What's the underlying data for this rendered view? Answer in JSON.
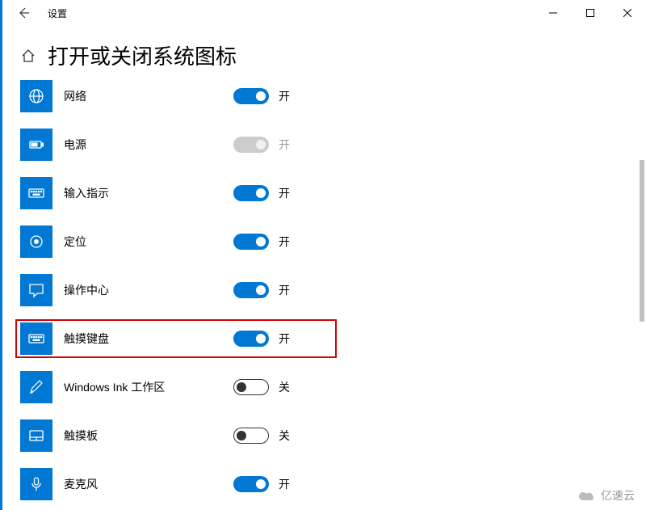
{
  "window": {
    "title": "设置"
  },
  "page": {
    "heading": "打开或关闭系统图标"
  },
  "state_labels": {
    "on": "开",
    "off": "关"
  },
  "items": [
    {
      "id": "network",
      "label": "网络",
      "state": "on",
      "highlight": false
    },
    {
      "id": "power",
      "label": "电源",
      "state": "disabled",
      "highlight": false
    },
    {
      "id": "input",
      "label": "输入指示",
      "state": "on",
      "highlight": false
    },
    {
      "id": "location",
      "label": "定位",
      "state": "on",
      "highlight": false
    },
    {
      "id": "action-center",
      "label": "操作中心",
      "state": "on",
      "highlight": false
    },
    {
      "id": "touch-keyboard",
      "label": "触摸键盘",
      "state": "on",
      "highlight": true
    },
    {
      "id": "windows-ink",
      "label": "Windows Ink 工作区",
      "state": "off",
      "highlight": false
    },
    {
      "id": "touchpad",
      "label": "触摸板",
      "state": "off",
      "highlight": false
    },
    {
      "id": "microphone",
      "label": "麦克风",
      "state": "on",
      "highlight": false
    }
  ],
  "watermark": {
    "text": "亿速云"
  }
}
